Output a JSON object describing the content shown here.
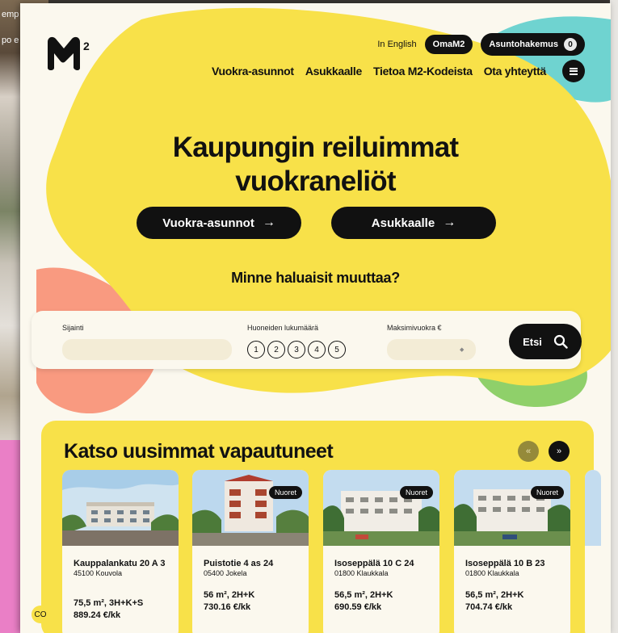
{
  "background_page": {
    "text_line_1": "emp",
    "text_line_2": "po e"
  },
  "colors": {
    "brand_yellow": "#f8e149",
    "ink": "#111111",
    "cream": "#fbf8ee",
    "teal": "#6fd3d0",
    "salmon": "#f99a80",
    "green": "#8fd06a",
    "pink": "#ea7fc6"
  },
  "header": {
    "logo_label": "M²",
    "lang_link": "In English",
    "oma_button": "OmaM2",
    "application_button": "Asuntohakemus",
    "application_count": "0",
    "nav": [
      "Vuokra-asunnot",
      "Asukkaalle",
      "Tietoa M2-Kodeista",
      "Ota yhteyttä"
    ],
    "menu_icon": "hamburger-menu-icon"
  },
  "hero": {
    "title_line_1": "Kaupungin reiluimmat",
    "title_line_2": "vuokraneliöt",
    "button_1": "Vuokra-asunnot",
    "button_2": "Asukkaalle",
    "arrow": "→"
  },
  "search": {
    "heading": "Minne haluaisit muuttaa?",
    "location_label": "Sijainti",
    "location_value": "",
    "rooms_label": "Huoneiden lukumäärä",
    "rooms": [
      "1",
      "2",
      "3",
      "4",
      "5"
    ],
    "rent_label": "Maksimivuokra €",
    "rent_value": "",
    "submit_label": "Etsi",
    "submit_icon": "search-icon"
  },
  "listings": {
    "title": "Katso uusimmat vapautuneet",
    "prev_label": "«",
    "next_label": "»",
    "cards": [
      {
        "badge": "",
        "address": "Kauppalankatu 20 A 3",
        "city": "45100 Kouvola",
        "area": "75,5 m², 3H+K+S",
        "rent": "889.24 €/kk"
      },
      {
        "badge": "Nuoret",
        "address": "Puistotie 4 as 24",
        "city": "05400 Jokela",
        "area": "56 m², 2H+K",
        "rent": "730.16 €/kk"
      },
      {
        "badge": "Nuoret",
        "address": "Isoseppälä 10 C 24",
        "city": "01800 Klaukkala",
        "area": "56,5 m², 2H+K",
        "rent": "690.59 €/kk"
      },
      {
        "badge": "Nuoret",
        "address": "Isoseppälä 10 B 23",
        "city": "01800 Klaukkala",
        "area": "56,5 m², 2H+K",
        "rent": "704.74 €/kk"
      }
    ]
  },
  "cookie_icon": "cookie-settings-icon",
  "cookie_label": "CO"
}
